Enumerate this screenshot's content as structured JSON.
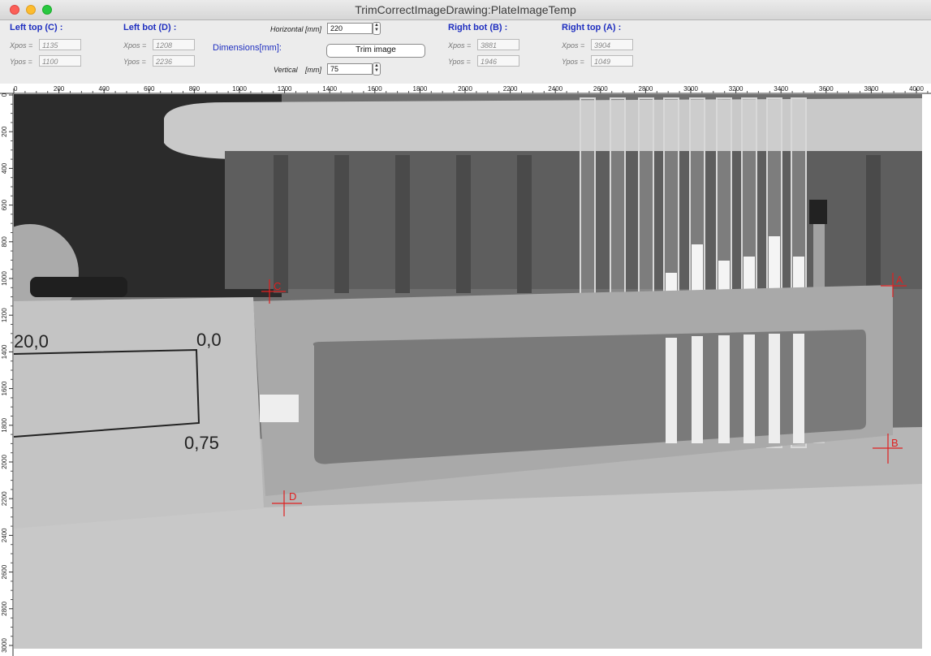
{
  "window": {
    "title": "TrimCorrectImageDrawing:PlateImageTemp"
  },
  "left_top": {
    "title": "Left top (C) :",
    "xpos_label": "Xpos =",
    "xpos": "1135",
    "ypos_label": "Ypos =",
    "ypos": "1100"
  },
  "left_bot": {
    "title": "Left bot (D) :",
    "xpos_label": "Xpos =",
    "xpos": "1208",
    "ypos_label": "Ypos =",
    "ypos": "2236"
  },
  "dimensions": {
    "title": "Dimensions[mm]:",
    "horizontal_label": "Horizontal [mm]",
    "horizontal": "220",
    "vertical_label": "Vertical",
    "vertical_unit": "[mm]",
    "vertical": "75",
    "trim_button": "Trim image"
  },
  "right_bot": {
    "title": "Right bot (B) :",
    "xpos_label": "Xpos =",
    "xpos": "3881",
    "ypos_label": "Ypos =",
    "ypos": "1946"
  },
  "right_top": {
    "title": "Right top (A) :",
    "xpos_label": "Xpos =",
    "xpos": "3904",
    "ypos_label": "Ypos =",
    "ypos": "1049"
  },
  "ruler": {
    "x_ticks": [
      "0",
      "200",
      "400",
      "600",
      "800",
      "1000",
      "1200",
      "1400",
      "1600",
      "1800",
      "2000",
      "2200",
      "2400",
      "2600",
      "2800",
      "3000",
      "3200",
      "3400",
      "3600",
      "3800",
      "4000"
    ],
    "y_ticks": [
      "0",
      "200",
      "400",
      "600",
      "800",
      "1000",
      "1200",
      "1400",
      "1600",
      "1800",
      "2000",
      "2200",
      "2400",
      "2600",
      "2800",
      "3000"
    ]
  },
  "markers": {
    "a": "A",
    "b": "B",
    "c": "C",
    "d": "D"
  },
  "note_text": {
    "left_top": "20,0",
    "right_top": "0,0",
    "right_bot": "0,75"
  },
  "colors": {
    "group_title": "#1f2fc0",
    "marker": "#e02020"
  }
}
